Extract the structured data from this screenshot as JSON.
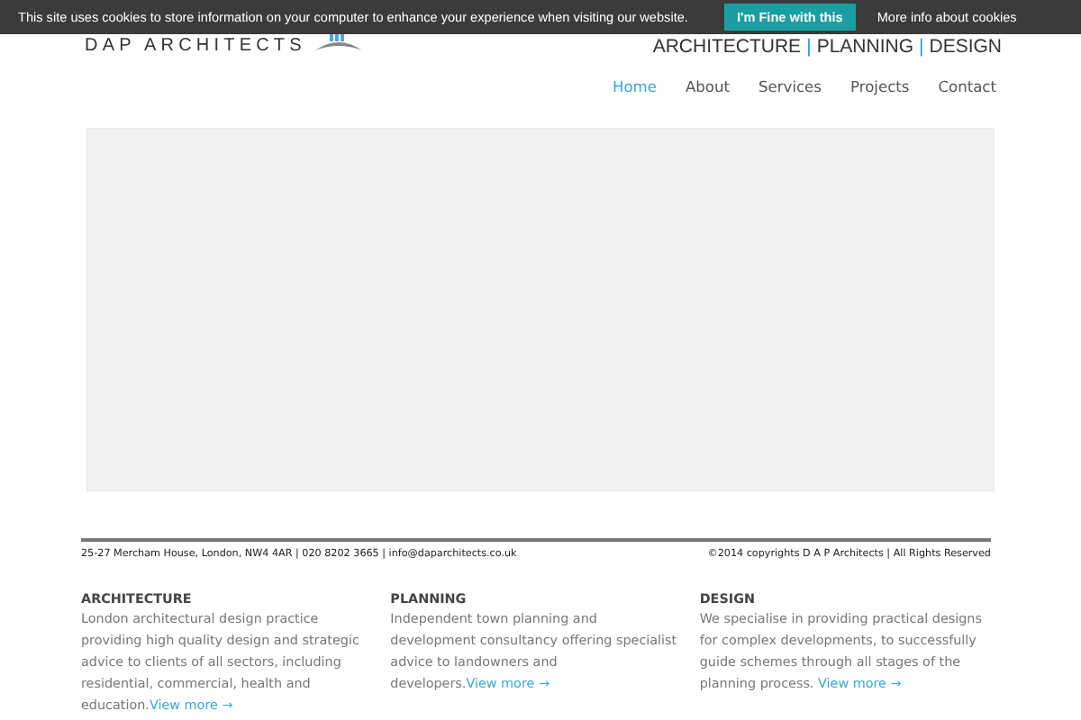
{
  "cookie_bar": {
    "message": "This site uses cookies to store information on your computer to enhance your experience when visiting our website.",
    "accept_button": "I'm Fine with this",
    "more_link": "More info about cookies"
  },
  "header": {
    "logo": "DAP ARCHITECTS",
    "tagline": [
      {
        "kind": "word",
        "text": "ARCHITECTURE"
      },
      {
        "kind": "separator",
        "text": "|"
      },
      {
        "kind": "word",
        "text": "PLANNING"
      },
      {
        "kind": "separator",
        "text": "|"
      },
      {
        "kind": "word",
        "text": "DESIGN"
      }
    ]
  },
  "nav": [
    {
      "label": "Home",
      "selected": true
    },
    {
      "label": "About",
      "selected": false
    },
    {
      "label": "Services",
      "selected": false
    },
    {
      "label": "Projects",
      "selected": false
    },
    {
      "label": "Contact",
      "selected": false
    }
  ],
  "footer": {
    "address": "25-27 Mercham House, London, NW4 4AR  | 020 8202 3665 | info@daparchitects.co.uk",
    "copyright": "©2014 copyrights D A P Architects | All Rights Reserved",
    "columns": [
      {
        "title": "ARCHITECTURE",
        "text": "London architectural design practice providing high quality design and strategic advice to clients of all sectors, including residential, commercial, health and education.",
        "link": "View more →"
      },
      {
        "title": "PLANNING",
        "text": "Independent town planning and development consultancy offering specialist advice to landowners and developers.",
        "link": "View more →"
      },
      {
        "title": "DESIGN",
        "text": "We specialise in providing practical designs for complex developments, to successfully guide schemes through all stages of the planning process. ",
        "link": "View more →"
      }
    ]
  }
}
